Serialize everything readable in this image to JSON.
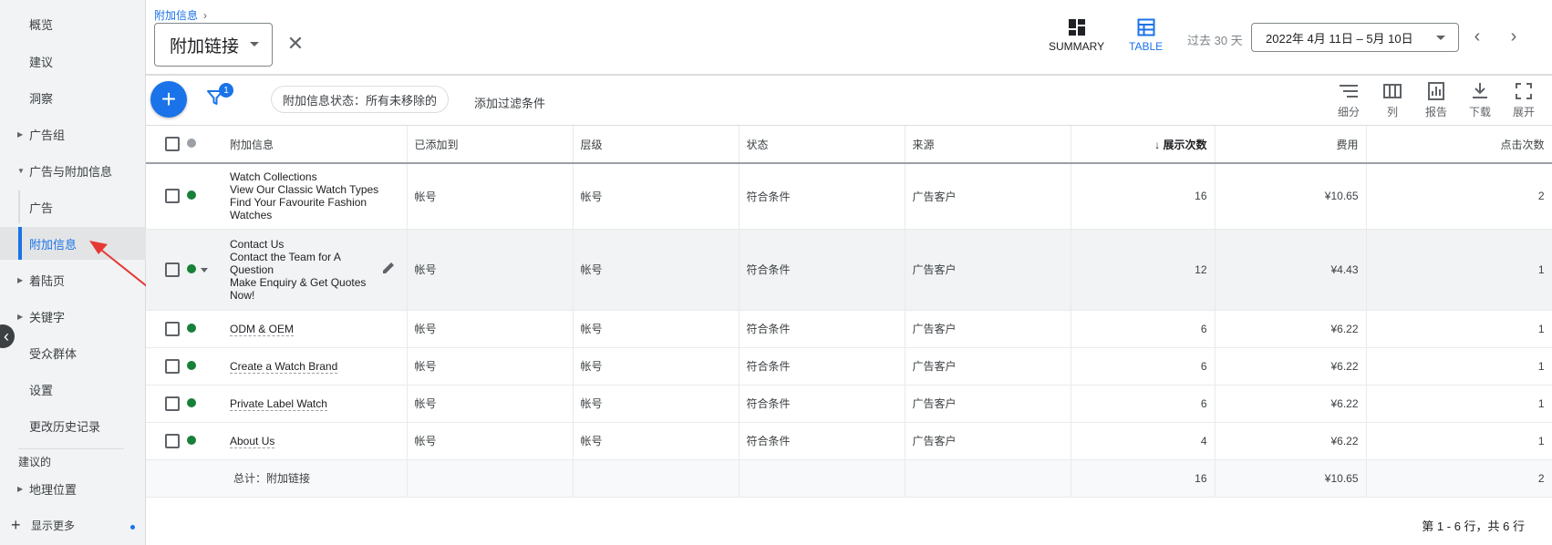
{
  "sidebar": {
    "items": [
      {
        "label": "概览",
        "type": "item"
      },
      {
        "label": "建议",
        "type": "item"
      },
      {
        "label": "洞察",
        "type": "item"
      },
      {
        "label": "广告组",
        "type": "collapsed"
      },
      {
        "label": "广告与附加信息",
        "type": "expanded"
      },
      {
        "label": "广告",
        "type": "sub"
      },
      {
        "label": "附加信息",
        "type": "sub-active"
      },
      {
        "label": "着陆页",
        "type": "collapsed"
      },
      {
        "label": "关键字",
        "type": "collapsed"
      },
      {
        "label": "受众群体",
        "type": "item"
      },
      {
        "label": "设置",
        "type": "item"
      },
      {
        "label": "更改历史记录",
        "type": "item"
      }
    ],
    "section_label": "建议的",
    "geo_item": "地理位置",
    "show_more": "显示更多",
    "collapse_icon": "chevron-left-icon"
  },
  "header": {
    "breadcrumb": "附加信息",
    "title": "附加链接",
    "view_summary": "SUMMARY",
    "view_table": "TABLE",
    "date_range_label": "过去 30 天",
    "date_range": "2022年 4月 11日 – 5月 10日"
  },
  "toolbar": {
    "filter_badge": "1",
    "filter_chip": "附加信息状态：所有未移除的",
    "add_filter": "添加过滤条件",
    "segment": "细分",
    "columns": "列",
    "reports": "报告",
    "download": "下载",
    "expand": "展开"
  },
  "table": {
    "headers": {
      "extension": "附加信息",
      "added_to": "已添加到",
      "level": "层级",
      "status": "状态",
      "source": "来源",
      "impressions": "展示次数",
      "cost": "费用",
      "clicks": "点击次数"
    },
    "rows": [
      {
        "lines": [
          "Watch Collections",
          "View Our Classic Watch Types",
          "Find Your Favourite Fashion",
          "Watches"
        ],
        "added_to": "帐号",
        "level": "帐号",
        "status": "符合条件",
        "source": "广告客户",
        "impressions": "16",
        "cost": "¥10.65",
        "clicks": "2"
      },
      {
        "lines": [
          "Contact Us",
          "Contact the Team for A",
          "Question",
          "Make Enquiry & Get Quotes",
          "Now!"
        ],
        "added_to": "帐号",
        "level": "帐号",
        "status": "符合条件",
        "source": "广告客户",
        "impressions": "12",
        "cost": "¥4.43",
        "clicks": "1"
      },
      {
        "lines": [
          "ODM & OEM"
        ],
        "added_to": "帐号",
        "level": "帐号",
        "status": "符合条件",
        "source": "广告客户",
        "impressions": "6",
        "cost": "¥6.22",
        "clicks": "1"
      },
      {
        "lines": [
          "Create a Watch Brand"
        ],
        "added_to": "帐号",
        "level": "帐号",
        "status": "符合条件",
        "source": "广告客户",
        "impressions": "6",
        "cost": "¥6.22",
        "clicks": "1"
      },
      {
        "lines": [
          "Private Label Watch"
        ],
        "added_to": "帐号",
        "level": "帐号",
        "status": "符合条件",
        "source": "广告客户",
        "impressions": "6",
        "cost": "¥6.22",
        "clicks": "1"
      },
      {
        "lines": [
          "About Us"
        ],
        "added_to": "帐号",
        "level": "帐号",
        "status": "符合条件",
        "source": "广告客户",
        "impressions": "4",
        "cost": "¥6.22",
        "clicks": "1"
      }
    ],
    "total": {
      "label": "总计：附加链接",
      "impressions": "16",
      "cost": "¥10.65",
      "clicks": "2"
    }
  },
  "pagination": "第 1 - 6 行，共 6 行",
  "colors": {
    "accent": "#1a73e8",
    "status_green": "#188038",
    "annotation_red": "#e53935"
  }
}
